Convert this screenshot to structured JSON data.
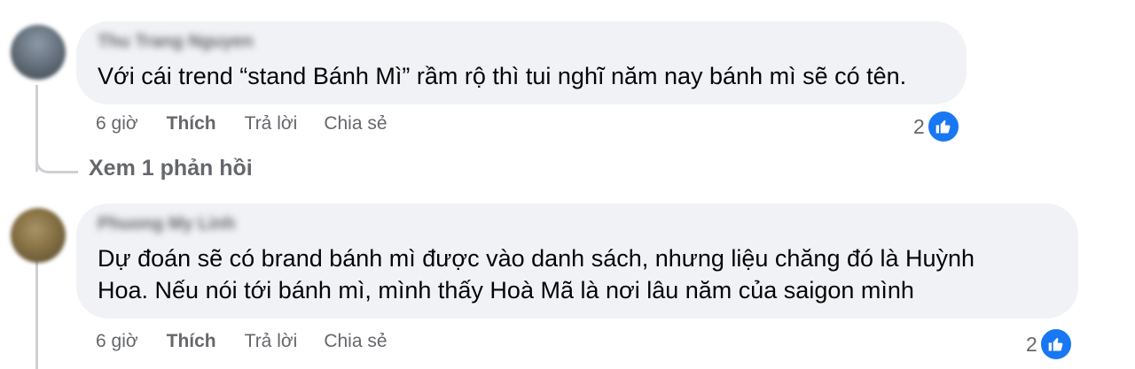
{
  "comments": [
    {
      "author": "Thu Trang Nguyen",
      "text": "Với cái trend “stand Bánh Mì” rầm rộ thì tui nghĩ năm nay bánh mì sẽ có tên.",
      "time": "6 giờ",
      "like_label": "Thích",
      "reply_label": "Trả lời",
      "share_label": "Chia sẻ",
      "reaction_count": "2",
      "reaction_icon": "like-icon",
      "view_replies": "Xem 1 phản hồi"
    },
    {
      "author": "Phuong My Linh",
      "text": "Dự đoán sẽ có brand bánh mì được vào danh sách, nhưng liệu chăng đó là Huỳnh\nHoa. Nếu nói tới bánh mì, mình thấy Hoà Mã là nơi lâu năm của saigon mình",
      "time": "6 giờ",
      "like_label": "Thích",
      "reply_label": "Trả lời",
      "share_label": "Chia sẻ",
      "reaction_count": "2",
      "reaction_icon": "like-icon"
    }
  ],
  "colors": {
    "bubble_bg": "#f0f2f5",
    "meta_text": "#65676b",
    "like_blue": "#1877f2",
    "thread_line": "#ced0d4"
  }
}
